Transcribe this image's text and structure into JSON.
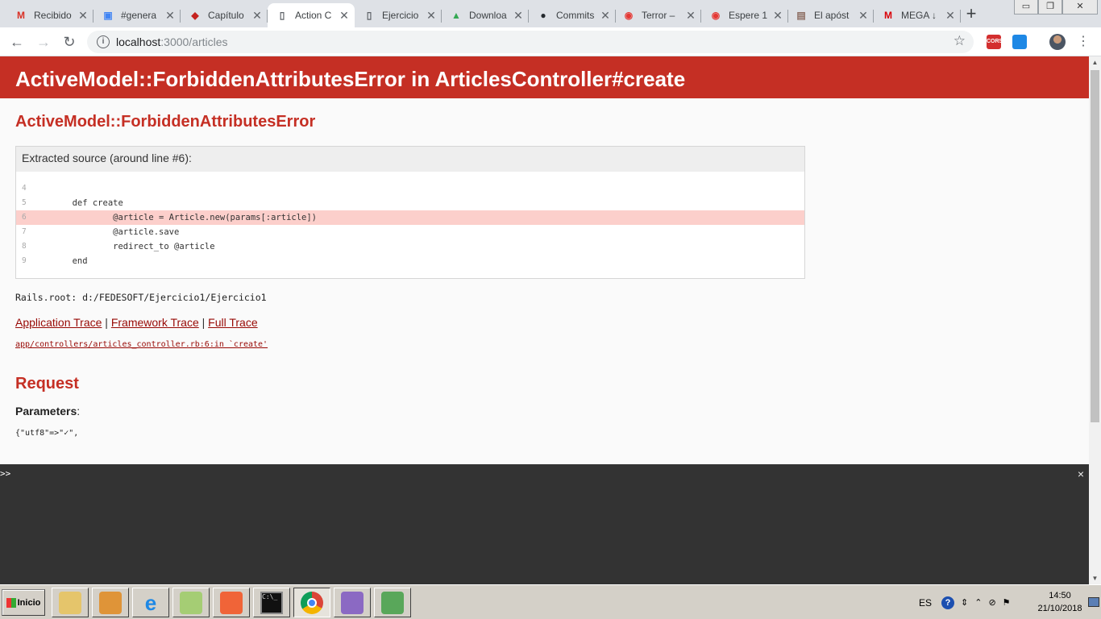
{
  "browser": {
    "tabs": [
      {
        "title": "Recibido",
        "favicon": "gmail-icon",
        "fav_color": "#d93025",
        "fav_glyph": "M"
      },
      {
        "title": "#genera",
        "favicon": "slack-calendar-icon",
        "fav_color": "#4285f4",
        "fav_glyph": "▣"
      },
      {
        "title": "Capítulo",
        "favicon": "book-icon",
        "fav_color": "#c5221f",
        "fav_glyph": "◆"
      },
      {
        "title": "Action C",
        "favicon": "document-icon",
        "fav_color": "#5f6368",
        "fav_glyph": "▯",
        "active": true
      },
      {
        "title": "Ejercicio",
        "favicon": "document-icon",
        "fav_color": "#5f6368",
        "fav_glyph": "▯"
      },
      {
        "title": "Downloa",
        "favicon": "google-drive-icon",
        "fav_color": "#34a853",
        "fav_glyph": "▲"
      },
      {
        "title": "Commits",
        "favicon": "github-icon",
        "fav_color": "#24292e",
        "fav_glyph": "●"
      },
      {
        "title": "Terror –",
        "favicon": "play-circle-icon",
        "fav_color": "#e53935",
        "fav_glyph": "◉"
      },
      {
        "title": "Espere 1",
        "favicon": "play-circle-icon",
        "fav_color": "#e53935",
        "fav_glyph": "◉"
      },
      {
        "title": "El apóst",
        "favicon": "clipboard-icon",
        "fav_color": "#8d6e63",
        "fav_glyph": "▤"
      },
      {
        "title": "MEGA ↓",
        "favicon": "mega-icon",
        "fav_color": "#d90007",
        "fav_glyph": "M"
      }
    ],
    "new_tab_glyph": "+",
    "url_host": "localhost",
    "url_path": ":3000/articles",
    "window_buttons": [
      "▭",
      "❐",
      "✕"
    ]
  },
  "page": {
    "header_title": "ActiveModel::ForbiddenAttributesError in ArticlesController#create",
    "exception_title": "ActiveModel::ForbiddenAttributesError",
    "source_header": "Extracted source (around line ",
    "source_line_ref": "#6",
    "source_header_end": "):",
    "source_lines": [
      {
        "num": "4",
        "code": ""
      },
      {
        "num": "5",
        "code": "        def create"
      },
      {
        "num": "6",
        "code": "                @article = Article.new(params[:article])",
        "highlight": true
      },
      {
        "num": "7",
        "code": "                @article.save"
      },
      {
        "num": "8",
        "code": "                redirect_to @article"
      },
      {
        "num": "9",
        "code": "        end"
      }
    ],
    "rails_root": "Rails.root: d:/FEDESOFT/Ejercicio1/Ejercicio1",
    "trace_links": [
      "Application Trace",
      "Framework Trace",
      "Full Trace"
    ],
    "trace_sep": "|",
    "trace_line": "app/controllers/articles_controller.rb:6:in `create'",
    "request_title": "Request",
    "parameters_label": "Parameters",
    "parameters_colon": ":",
    "params_text": "{\"utf8\"=>\"✓\","
  },
  "console": {
    "prompt": ">>",
    "close": "×"
  },
  "taskbar": {
    "start_label": "Inicio",
    "apps": [
      {
        "name": "file-explorer-icon",
        "color": "#e8c35a"
      },
      {
        "name": "media-player-icon",
        "color": "#e08a1e"
      },
      {
        "name": "internet-explorer-icon",
        "color": "#1e88e5"
      },
      {
        "name": "folder-map-icon",
        "color": "#9ccc65"
      },
      {
        "name": "git-icon",
        "color": "#f4511e"
      },
      {
        "name": "command-prompt-icon",
        "color": "#111111"
      },
      {
        "name": "chrome-icon",
        "color": "#4285f4",
        "pressed": true
      },
      {
        "name": "paint-icon",
        "color": "#7e57c2"
      },
      {
        "name": "chart-app-icon",
        "color": "#43a047"
      }
    ],
    "language": "ES",
    "help_glyph": "?",
    "time": "14:50",
    "date": "21/10/2018"
  },
  "colors": {
    "rails_red": "#c52f24",
    "link_red": "#980905",
    "highlight": "#fccfcb",
    "console_bg": "#333333"
  }
}
